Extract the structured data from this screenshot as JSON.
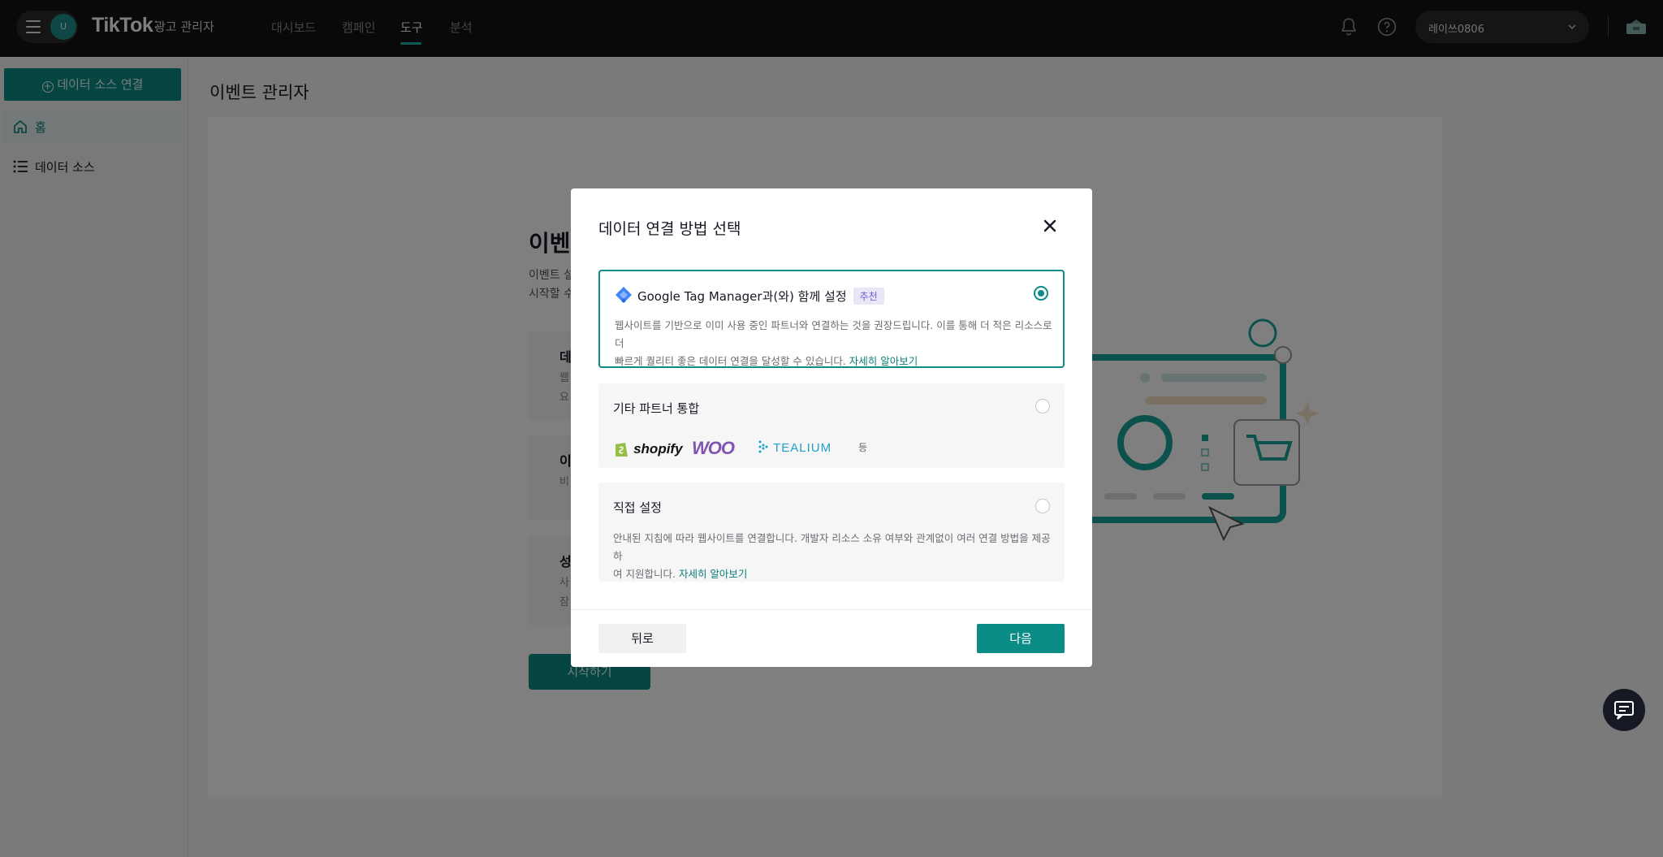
{
  "topbar": {
    "avatar_initial": "U",
    "brand": "TikTok",
    "brand_colon": ":",
    "brand_sub": "광고 관리자",
    "nav": [
      "대시보드",
      "캠페인",
      "도구",
      "분석"
    ],
    "active_nav": "도구",
    "account_name": "레이쓰0806"
  },
  "sidebar": {
    "connect_button": "데이터 소스 연결",
    "items": [
      {
        "label": "홈",
        "icon": "home-icon",
        "active": true
      },
      {
        "label": "데이터 소스",
        "icon": "list-icon",
        "active": false
      }
    ]
  },
  "main": {
    "page_title": "이벤트 관리자",
    "bg_heading": "이벤",
    "bg_line1": "이벤트 설",
    "bg_line2": "시작할 수",
    "tiles": [
      {
        "title": "데",
        "lines": [
          "웹",
          "요"
        ]
      },
      {
        "title": "이",
        "lines": [
          "비"
        ]
      },
      {
        "title": "성",
        "lines": [
          "사",
          "잠"
        ]
      }
    ],
    "start_button": "시작하기"
  },
  "modal": {
    "title": "데이터 연결 방법 선택",
    "options": [
      {
        "title": "Google Tag Manager과(와) 함께 설정",
        "badge": "추천",
        "desc_1": "웹사이트를 기반으로 이미 사용 중인 파트너와 연결하는 것을 권장드립니다. 이를 통해 더 적은 리소스로 더",
        "desc_2": "빠르게 퀄리티 좋은 데이터 연결을 달성할 수 있습니다.",
        "link": "자세히 알아보기",
        "selected": true
      },
      {
        "title": "기타 파트너 통합",
        "partners": [
          "shopify",
          "WOO",
          "TEALIUM"
        ],
        "etc": "등",
        "selected": false
      },
      {
        "title": "직접 설정",
        "desc_1": "안내된 지침에 따라 웹사이트를 연결합니다. 개발자 리소스 소유 여부와 관계없이 여러 연결 방법을 제공하",
        "desc_2": "여 지원합니다.",
        "link": "자세히 알아보기",
        "selected": false
      }
    ],
    "back_button": "뒤로",
    "next_button": "다음"
  },
  "colors": {
    "accent": "#0b8c86",
    "badge_bg": "#e9e7f7",
    "badge_text": "#6c5fc7"
  }
}
